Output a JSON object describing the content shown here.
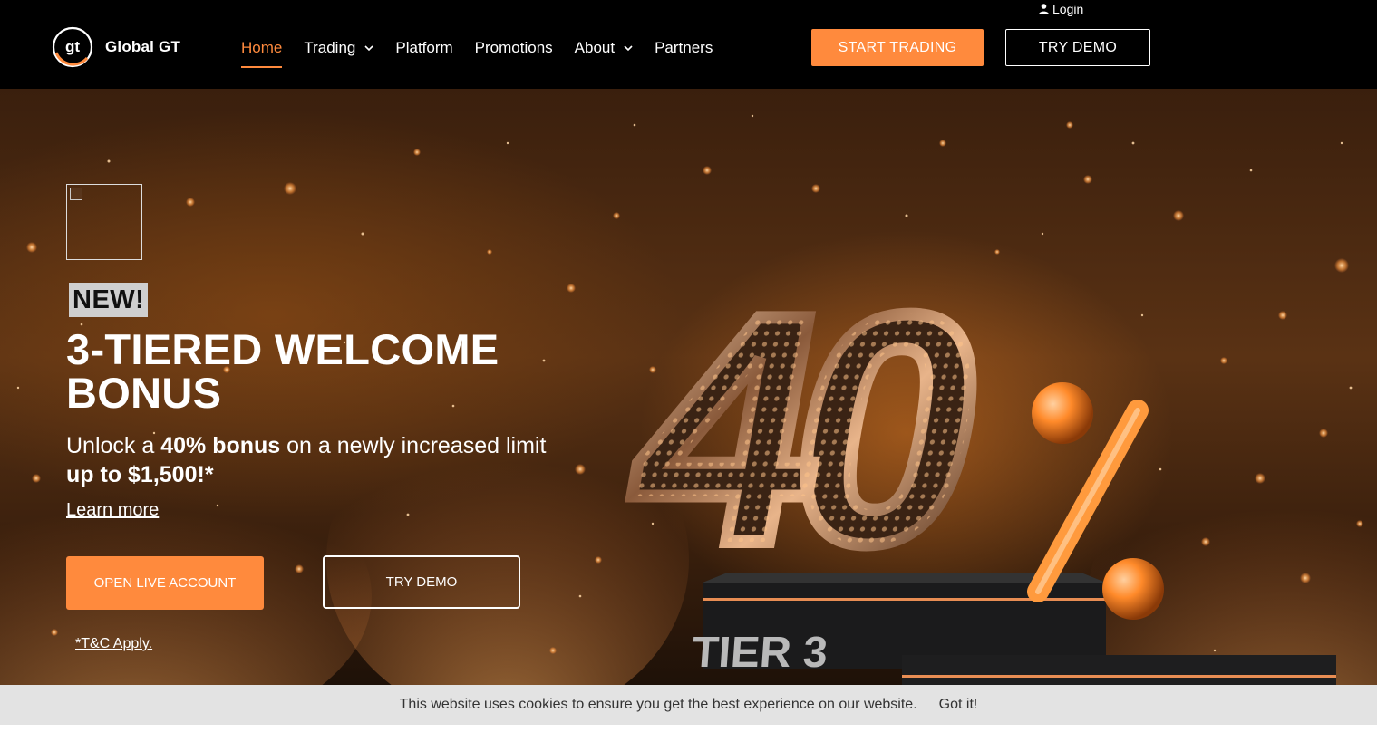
{
  "header": {
    "login_label": "Login",
    "brand_name": "Global GT",
    "logo_letters": "gt",
    "nav": [
      {
        "label": "Home",
        "active": true
      },
      {
        "label": "Trading",
        "dropdown": true
      },
      {
        "label": "Platform"
      },
      {
        "label": "Promotions"
      },
      {
        "label": "About",
        "dropdown": true
      },
      {
        "label": "Partners"
      }
    ],
    "start_trading_label": "START TRADING",
    "try_demo_label": "TRY DEMO"
  },
  "hero": {
    "badge": "NEW!",
    "title": "3-TIERED WELCOME BONUS",
    "subtitle_part1": "Unlock a ",
    "subtitle_bold1": "40% bonus",
    "subtitle_part2": " on a newly increased limit ",
    "subtitle_bold2": "up to $1,500!*",
    "learn_more": "Learn more",
    "open_live_label": "OPEN LIVE ACCOUNT",
    "try_demo_label": "TRY DEMO",
    "tnc": "*T&C Apply.",
    "promo_number": "40",
    "promo_symbol": "%",
    "podium_label": "TIER 3"
  },
  "cookie": {
    "text": "This website uses cookies to ensure you get the best experience on our website.",
    "button": "Got it!"
  },
  "colors": {
    "accent": "#ff8a3d",
    "header_bg": "#000000",
    "cookie_bg": "#e3e3e3"
  }
}
